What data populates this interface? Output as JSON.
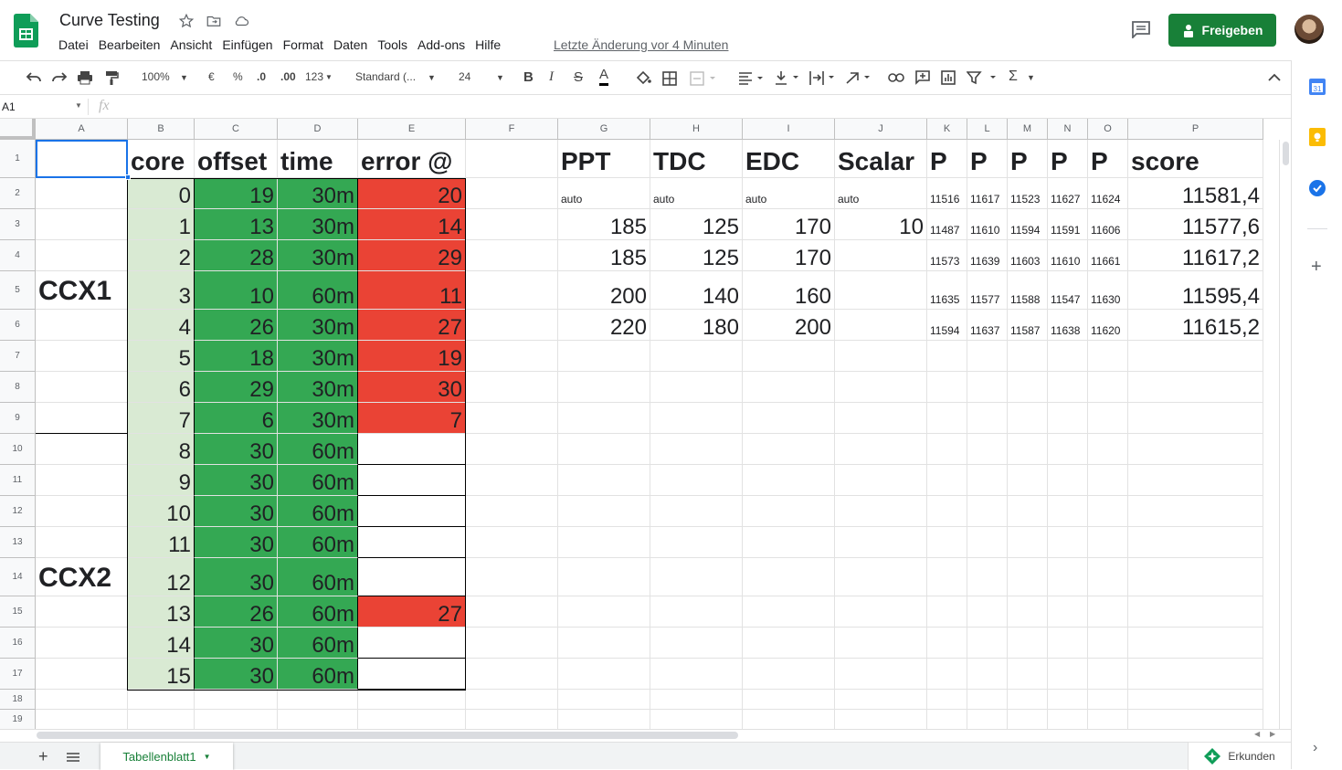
{
  "app": {
    "title": "Curve Testing",
    "menu": [
      "Datei",
      "Bearbeiten",
      "Ansicht",
      "Einfügen",
      "Format",
      "Daten",
      "Tools",
      "Add-ons",
      "Hilfe"
    ],
    "last_edit": "Letzte Änderung vor 4 Minuten",
    "share_label": "Freigeben",
    "accent": "#188038"
  },
  "toolbar": {
    "zoom": "100%",
    "currency": "€",
    "percent": "%",
    "dec_less": ".0",
    "dec_more": ".00",
    "number_format": "123",
    "font": "Standard (...",
    "font_size": "24",
    "bold": "B",
    "italic": "I",
    "strike": "S",
    "text_color": "A",
    "sum": "Σ"
  },
  "formula_bar": {
    "name_box": "A1",
    "fx": "fx",
    "value": ""
  },
  "columns": [
    "A",
    "B",
    "C",
    "D",
    "E",
    "F",
    "G",
    "H",
    "I",
    "J",
    "K",
    "L",
    "M",
    "N",
    "O",
    "P"
  ],
  "rows": [
    "1",
    "2",
    "3",
    "4",
    "5",
    "6",
    "7",
    "8",
    "9",
    "10",
    "11",
    "12",
    "13",
    "14",
    "15",
    "16",
    "17",
    "18",
    "19"
  ],
  "headers": {
    "core": "core",
    "offset": "offset",
    "time": "time",
    "error": "error @",
    "ppt": "PPT",
    "tdc": "TDC",
    "edc": "EDC",
    "scalar": "Scalar",
    "p1": "P",
    "p2": "P",
    "p3": "P",
    "p4": "P",
    "p5": "P",
    "score": "score"
  },
  "groups": {
    "ccx1": "CCX1",
    "ccx2": "CCX2"
  },
  "core_table": [
    {
      "core": "0",
      "offset": "19",
      "time": "30m",
      "error": "20"
    },
    {
      "core": "1",
      "offset": "13",
      "time": "30m",
      "error": "14"
    },
    {
      "core": "2",
      "offset": "28",
      "time": "30m",
      "error": "29"
    },
    {
      "core": "3",
      "offset": "10",
      "time": "60m",
      "error": "11"
    },
    {
      "core": "4",
      "offset": "26",
      "time": "30m",
      "error": "27"
    },
    {
      "core": "5",
      "offset": "18",
      "time": "30m",
      "error": "19"
    },
    {
      "core": "6",
      "offset": "29",
      "time": "30m",
      "error": "30"
    },
    {
      "core": "7",
      "offset": "6",
      "time": "30m",
      "error": "7"
    },
    {
      "core": "8",
      "offset": "30",
      "time": "60m",
      "error": ""
    },
    {
      "core": "9",
      "offset": "30",
      "time": "60m",
      "error": ""
    },
    {
      "core": "10",
      "offset": "30",
      "time": "60m",
      "error": ""
    },
    {
      "core": "11",
      "offset": "30",
      "time": "60m",
      "error": ""
    },
    {
      "core": "12",
      "offset": "30",
      "time": "60m",
      "error": ""
    },
    {
      "core": "13",
      "offset": "26",
      "time": "60m",
      "error": "27"
    },
    {
      "core": "14",
      "offset": "30",
      "time": "60m",
      "error": ""
    },
    {
      "core": "15",
      "offset": "30",
      "time": "60m",
      "error": ""
    }
  ],
  "pbo_table": [
    {
      "ppt": "auto",
      "tdc": "auto",
      "edc": "auto",
      "scalar": "auto",
      "p": [
        "11516",
        "11617",
        "11523",
        "11627",
        "11624"
      ],
      "score": "11581,4"
    },
    {
      "ppt": "185",
      "tdc": "125",
      "edc": "170",
      "scalar": "10",
      "p": [
        "11487",
        "11610",
        "11594",
        "11591",
        "11606"
      ],
      "score": "11577,6"
    },
    {
      "ppt": "185",
      "tdc": "125",
      "edc": "170",
      "scalar": "",
      "p": [
        "11573",
        "11639",
        "11603",
        "11610",
        "11661"
      ],
      "score": "11617,2"
    },
    {
      "ppt": "200",
      "tdc": "140",
      "edc": "160",
      "scalar": "",
      "p": [
        "11635",
        "11577",
        "11588",
        "11547",
        "11630"
      ],
      "score": "11595,4"
    },
    {
      "ppt": "220",
      "tdc": "180",
      "edc": "200",
      "scalar": "",
      "p": [
        "11594",
        "11637",
        "11587",
        "11638",
        "11620"
      ],
      "score": "11615,2"
    }
  ],
  "bottom": {
    "sheet_name": "Tabellenblatt1",
    "explore": "Erkunden"
  },
  "colors": {
    "light_green": "#d9ead3",
    "green": "#34a853",
    "red": "#ea4335",
    "brand_green": "#188038"
  }
}
